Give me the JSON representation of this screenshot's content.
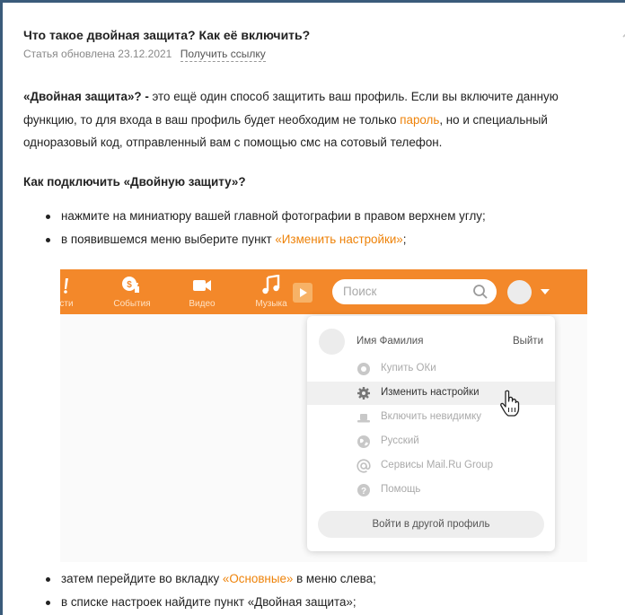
{
  "article": {
    "title": "Что такое двойная защита? Как её включить?",
    "updated": "Статья обновлена 23.12.2021",
    "get_link": "Получить ссылку",
    "para_bold": "«Двойная защита»? -",
    "para_1": " это ещё один способ защитить ваш профиль. Если вы включите данную функцию, то для входа в ваш профиль будет необходим не только ",
    "para_link": "пароль",
    "para_2": ", но и специальный одноразовый код, отправленный вам с помощью смс на сотовый телефон.",
    "heading": "Как подключить «Двойную защиту»?",
    "steps_top": {
      "s1": "нажмите на миниатюру вашей главной фотографии в правом верхнем углу;",
      "s2_pre": "в появившемся меню выберите пункт ",
      "s2_link": "«Изменить настройки»",
      "s2_post": ";"
    },
    "steps_bottom": {
      "s3_pre": "затем перейдите во вкладку ",
      "s3_link": "«Основные»",
      "s3_post": " в меню слева;",
      "s4": "в списке настроек найдите пункт «Двойная защита»;"
    }
  },
  "screenshot": {
    "nav": {
      "item0": "сти",
      "item1": "События",
      "item2": "Видео",
      "item3": "Музыка"
    },
    "search_placeholder": "Поиск",
    "dropdown": {
      "user_name": "Имя Фамилия",
      "exit": "Выйти",
      "items": [
        {
          "label": "Купить ОКи",
          "icon": "ok-coin-icon"
        },
        {
          "label": "Изменить настройки",
          "icon": "gear-icon"
        },
        {
          "label": "Включить невидимку",
          "icon": "hat-icon"
        },
        {
          "label": "Русский",
          "icon": "globe-icon"
        },
        {
          "label": "Сервисы Mail.Ru Group",
          "icon": "at-icon"
        },
        {
          "label": "Помощь",
          "icon": "help-icon"
        }
      ],
      "other_profile": "Войти в другой профиль"
    }
  },
  "colors": {
    "accent_orange": "#ee8208",
    "bar_orange": "#f3882a"
  }
}
